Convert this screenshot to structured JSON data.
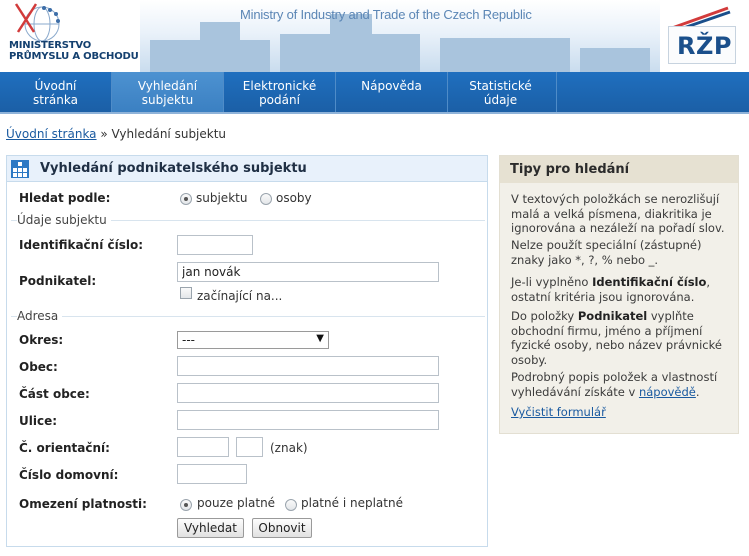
{
  "header": {
    "ministry_line1": "MINISTERSTVO",
    "ministry_line2": "PRŮMYSLU A OBCHODU",
    "banner_title": "Ministry of Industry and Trade of the Czech Republic",
    "rzp_logo_text": "RŽP"
  },
  "nav": {
    "items": [
      {
        "line1": "Úvodní",
        "line2": "stránka"
      },
      {
        "line1": "Vyhledání",
        "line2": "subjektu"
      },
      {
        "line1": "Elektronické",
        "line2": "podání"
      },
      {
        "line1": "Nápověda",
        "line2": ""
      },
      {
        "line1": "Statistické",
        "line2": "údaje"
      }
    ],
    "active_item": "Vyhledání subjektu"
  },
  "breadcrumb": {
    "home": "Úvodní stránka",
    "separator": "»",
    "current": "Vyhledání subjektu"
  },
  "form": {
    "title": "Vyhledání podnikatelského subjektu",
    "search_by_label": "Hledat podle:",
    "search_by_options": [
      "subjektu",
      "osoby"
    ],
    "search_by_selected": "subjektu",
    "section_subject": "Údaje subjektu",
    "id_label": "Identifikační číslo:",
    "id_value": "",
    "business_label": "Podnikatel:",
    "business_value": "jan novák",
    "starts_with_label": "začínající na...",
    "section_address": "Adresa",
    "district_label": "Okres:",
    "district_value": "---",
    "town_label": "Obec:",
    "town_value": "",
    "town_part_label": "Část obce:",
    "town_part_value": "",
    "street_label": "Ulice:",
    "street_value": "",
    "orient_label": "Č. orientační:",
    "orient_value": "",
    "orient_letter_value": "",
    "orient_letter_hint": "(znak)",
    "house_no_label": "Číslo domovní:",
    "house_no_value": "",
    "validity_label": "Omezení platnosti:",
    "validity_options": [
      "pouze platné",
      "platné i neplatné"
    ],
    "validity_selected": "pouze platné",
    "search_button": "Vyhledat",
    "reset_button": "Obnovit"
  },
  "tips": {
    "title": "Tipy pro hledání",
    "tip1": "V textových položkách se nerozlišují malá a velká písmena, diakritika je ignorována a nezáleží na pořadí slov.",
    "tip2": "Nelze použít speciální (zástupné) znaky jako *, ?, % nebo _.",
    "tip3_pre": "Je-li vyplněno ",
    "tip3_bold": "Identifikační číslo",
    "tip3_post": ", ostatní kritéria jsou ignorována.",
    "tip4_pre": "Do položky ",
    "tip4_bold": "Podnikatel",
    "tip4_post": " vyplňte obchodní firmu, jméno a příjmení fyzické osoby, nebo název právnické osoby.",
    "tip5_pre": "Podrobný popis položek a vlastností vyhledávání získáte v ",
    "tip5_link": "nápovědě",
    "tip5_post": ".",
    "clear_link": "Vyčistit formulář"
  },
  "colors": {
    "nav_blue": "#1f6fbf",
    "nav_active": "#4d92d1",
    "panel_head": "#e8f1fb",
    "tips_bg": "#f2f0e9",
    "link": "#1a5aa0"
  }
}
